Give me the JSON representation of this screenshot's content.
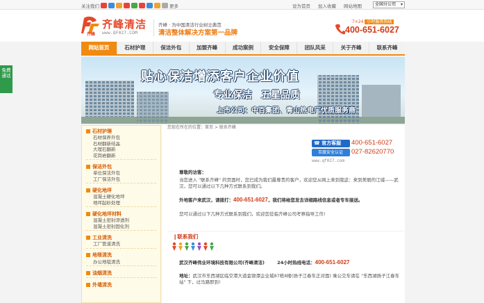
{
  "topbar": {
    "follow_label": "关注我们",
    "more_label": "更多",
    "social_colors": [
      "#e8433a",
      "#3b8ddc",
      "#f2a22b",
      "#e8433a",
      "#49a64a",
      "#e8433a",
      "#3b8ddc",
      "#f2a22b"
    ],
    "links": [
      "设为首页",
      "加入收藏",
      "网站地图"
    ],
    "branch_select": "全国分公司"
  },
  "header": {
    "logo_text": "齐峰清洁",
    "logo_mark_text": "齐峰",
    "logo_url": "www.QF027.COM",
    "slogan_line1": "齐峰 · 为中国清洁行业树立典范",
    "slogan_line2": "清洁整体解决方案第一品牌",
    "hotline_tag": "7×24",
    "hotline_label": "小时服务热线",
    "hotline_number": "400-651-6027"
  },
  "nav": {
    "items": [
      "网站首页",
      "石材护理",
      "保洁外包",
      "加盟齐峰",
      "成功案例",
      "安全保障",
      "团队风采",
      "关于齐峰",
      "联系齐峰"
    ],
    "active_index": 0
  },
  "banner": {
    "line1": "贴心保洁增添客户企业价值",
    "line2": "专业保洁 五星品质",
    "line3": "上市公司：中百集团、青山热电厂优质服务商"
  },
  "float_tab": {
    "line1": "免费",
    "line2": "通话"
  },
  "sidebar": {
    "groups": [
      {
        "title": "石材护理",
        "items": [
          "石材保养外包",
          "石材翻新结晶",
          "大理石翻新",
          "花岗岩翻新"
        ]
      },
      {
        "title": "保洁外包",
        "items": [
          "单位保洁外包",
          "工厂保洁外包"
        ]
      },
      {
        "title": "硬化地坪",
        "items": [
          "混凝土硬化地坪",
          "地坪起砂处理"
        ]
      },
      {
        "title": "硬化地坪材料",
        "items": [
          "混凝土密封渗透剂",
          "混凝土密封固化剂"
        ]
      },
      {
        "title": "工业清洗",
        "items": [
          "工厂管道清洗"
        ]
      },
      {
        "title": "地毯清洗",
        "items": [
          "办公地毯清洗"
        ]
      },
      {
        "title": "油烟清洗",
        "items": []
      },
      {
        "title": "外墙清洗",
        "items": []
      }
    ]
  },
  "main": {
    "breadcrumb": "您现在所在的位置：首页 > 联系齐峰",
    "badge_service": "官方客服",
    "badge_secure": "百度安全认证",
    "badge_phone1": "400-651-6027",
    "badge_phone2": "027-82620770",
    "badge_url": "www.qf027.com",
    "greeting": "尊敬的访客：",
    "para1": "当您进入 \"联系齐峰\" 的页面时，您已成为我们最尊贵的客户，欢迎您从网上来到我这：来到美丽的江城——武汉，您可以通过以下几种方式联系到我们。",
    "para2_prefix": "外地客户来武汉，请拨打：",
    "para2_phone": "400-651-6027",
    "para2_suffix": "，我们将给您发去详细路线信息或者专车接送。",
    "para3": "您可以通过以下几种方式联系到我们，欢迎您莅临齐峰公司考察指导工作!",
    "contact_heading": "联系我们",
    "company_name": "武汉齐峰伟业环境科技有限公司(齐峰清洁)",
    "hotline_label": "24小时热线电话：",
    "hotline_number": "400-651-6027",
    "address_label": "地址：",
    "address": "武汉市东西湖区临空港大道金银潭企业城87栋8楼(扬子江春车正对面) 乘公交车请在 \"东西湖扬子江春车站\" 下，过马路即到!"
  }
}
